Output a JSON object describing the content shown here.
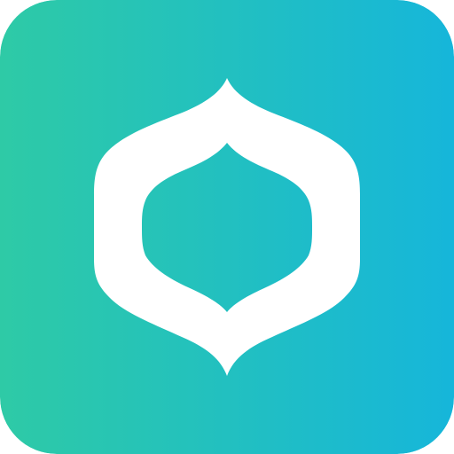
{
  "app_icon": {
    "shape": "rounded-square",
    "symbol": "onion-dome-ring-icon",
    "colors": {
      "gradient_start": "#2ecaa6",
      "gradient_end": "#16b6da",
      "symbol": "#ffffff"
    }
  }
}
